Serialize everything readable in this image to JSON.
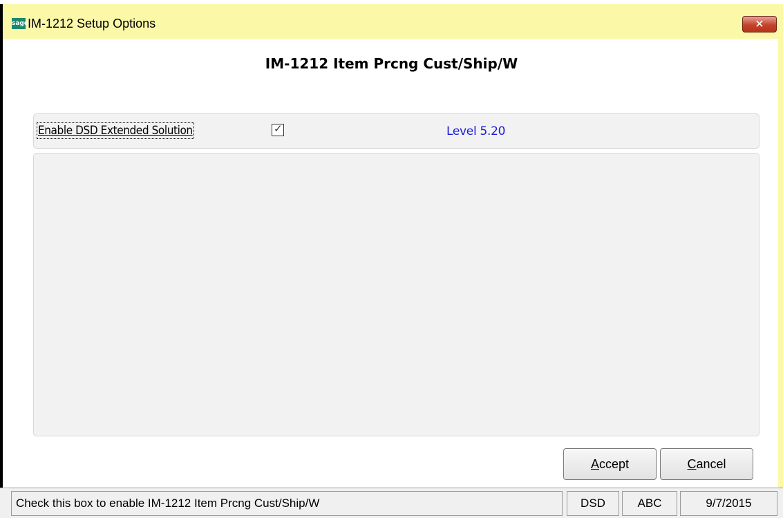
{
  "window": {
    "title": "IM-1212 Setup Options",
    "icon_text": "sage",
    "close_symbol": "✕"
  },
  "heading": "IM-1212 Item Prcng Cust/Ship/W",
  "option": {
    "label": "Enable DSD Extended Solution",
    "checked": true,
    "check_glyph": "✓",
    "level": "Level 5.20"
  },
  "buttons": {
    "accept_first": "A",
    "accept_rest": "ccept",
    "cancel_first": "C",
    "cancel_rest": "ancel"
  },
  "statusbar": {
    "message": "Check this box to enable IM-1212 Item Prcng Cust/Ship/W",
    "cell1": "DSD",
    "cell2": "ABC",
    "cell3": "9/7/2015"
  },
  "colors": {
    "titlebar": "#fbf9a8",
    "level_text": "#1a1ae0",
    "close_button": "#c4432b",
    "app_icon": "#1b8a6b"
  }
}
